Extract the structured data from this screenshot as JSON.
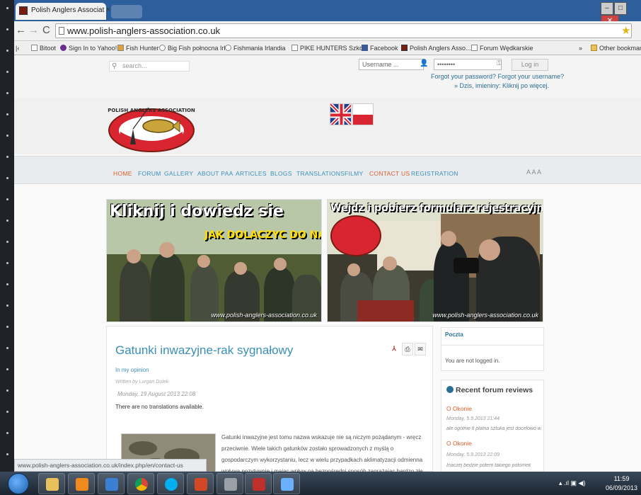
{
  "browser": {
    "tab_title": "Polish Anglers Associat",
    "close_glyph": "×",
    "url": "www.polish-anglers-association.co.uk",
    "window_buttons": [
      "–",
      "□",
      "✕"
    ],
    "bookmarks": [
      {
        "label": "Bitoot"
      },
      {
        "label": "Sign In to Yahoo!"
      },
      {
        "label": "Fish Hunter"
      },
      {
        "label": "Big Fish połnocna Irl..."
      },
      {
        "label": "Fishmania Irlandia"
      },
      {
        "label": "PIKE HUNTERS Szko..."
      },
      {
        "label": "Facebook"
      },
      {
        "label": "Polish Anglers Asso..."
      },
      {
        "label": "Forum Wędkarskie"
      },
      {
        "label": "Other bookmarks"
      }
    ]
  },
  "site": {
    "search_placeholder": "search...",
    "username_placeholder": "Username ...",
    "password_placeholder": "••••••••",
    "login_label": "Log in",
    "forgot_links": "Forgot your password?  Forgot your username?",
    "unread_link": "» Dzis, imieniny: Kliknij po więcej.",
    "logo_text": "POLISH ANGLERS ASSOCIATION",
    "menu": [
      "HOME",
      "FORUM",
      "GALLERY",
      "ABOUT PAA",
      "ARTICLES",
      "BLOGS",
      "TRANSLATIONS",
      "FILMY",
      "CONTACT US",
      "REGISTRATION"
    ],
    "font_resize": "A  A  A",
    "banner_left": {
      "title": "Kliknij i dowiedz sie",
      "subtitle": "JAK DOLACZYC DO NAS",
      "watermark": "www.polish-anglers-association.co.uk"
    },
    "banner_right": {
      "title": "Wejdz i pobierz formularz rejestracyjny",
      "watermark": "www.polish-anglers-association.co.uk"
    }
  },
  "article": {
    "title": "Gatunki inwazyjne-rak sygnałowy",
    "category": "In my opinion",
    "author": "Written by Lurgan Dulek",
    "date": "Monday, 19 August 2013 22:08",
    "no_translations": "There are no translations available.",
    "body": "Gatunki inwazyjne jest tomu nazwa wskazuje nie są niczym pożądanym - wręcz przeciwnie. Wiele takich gatunków zostało sprowadzonych z myślą o gospodarczym wykorzystaniu, lecz w wielu przypadkach aklimatyzacji odmienna wpływa pozytywnie i mając wpływ na bezpośredni sposób zagrażając bardzo złe wpływa na ekosystemy"
  },
  "sidebar": {
    "login_title": "Poczta",
    "not_logged": "You are not logged in.",
    "reviews_title": "Recent forum reviews",
    "reviews": [
      {
        "author": "O Okonie",
        "date": "Monday, 5.9.2013 21:44",
        "text": "ale ogólnie tl platna sztuka jest docelowo w"
      },
      {
        "author": "O Okonie",
        "date": "Monday, 5.9.2013 22:09",
        "text": "Inaczej bedzie potem takiego potomek"
      }
    ]
  },
  "status_url": "www.polish-anglers-association.co.uk/index.php/en/contact-us",
  "taskbar": {
    "time": "11:59",
    "date": "06/09/2013"
  }
}
